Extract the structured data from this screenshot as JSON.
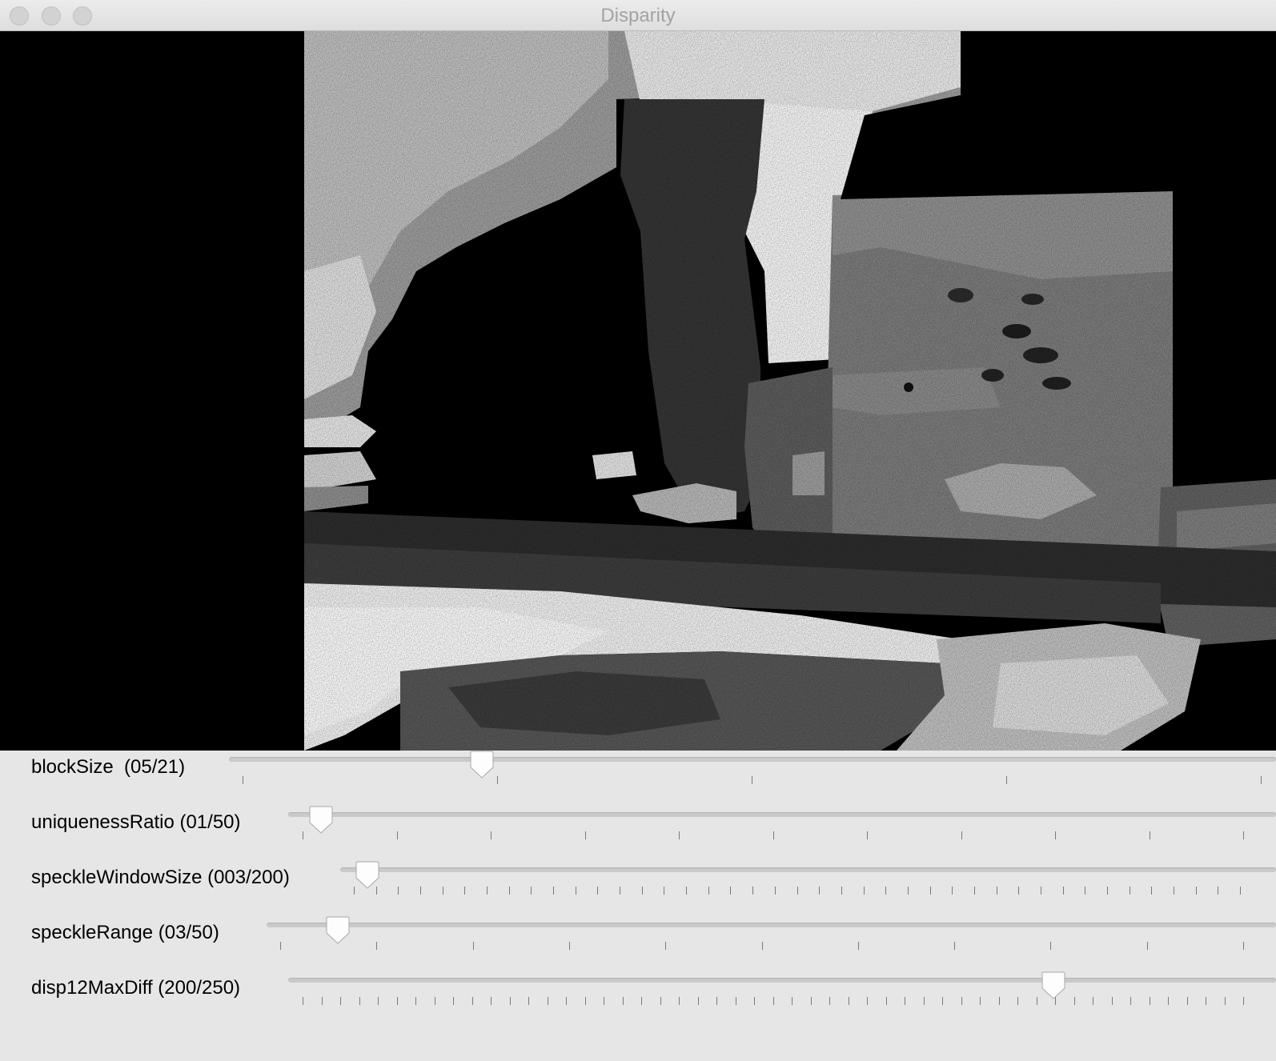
{
  "window": {
    "title": "Disparity"
  },
  "trackbars": [
    {
      "name": "blockSize",
      "label": "blockSize  (05/21)",
      "value": 5,
      "max": 21,
      "tick_intervals": 4
    },
    {
      "name": "uniquenessRatio",
      "label": "uniquenessRatio (01/50)",
      "value": 1,
      "max": 50,
      "tick_intervals": 10
    },
    {
      "name": "speckleWindowSize",
      "label": "speckleWindowSize (003/200)",
      "value": 3,
      "max": 200,
      "tick_intervals": 40
    },
    {
      "name": "speckleRange",
      "label": "speckleRange (03/50)",
      "value": 3,
      "max": 50,
      "tick_intervals": 10
    },
    {
      "name": "disp12MaxDiff",
      "label": "disp12MaxDiff (200/250)",
      "value": 200,
      "max": 250,
      "tick_intervals": 50
    }
  ]
}
